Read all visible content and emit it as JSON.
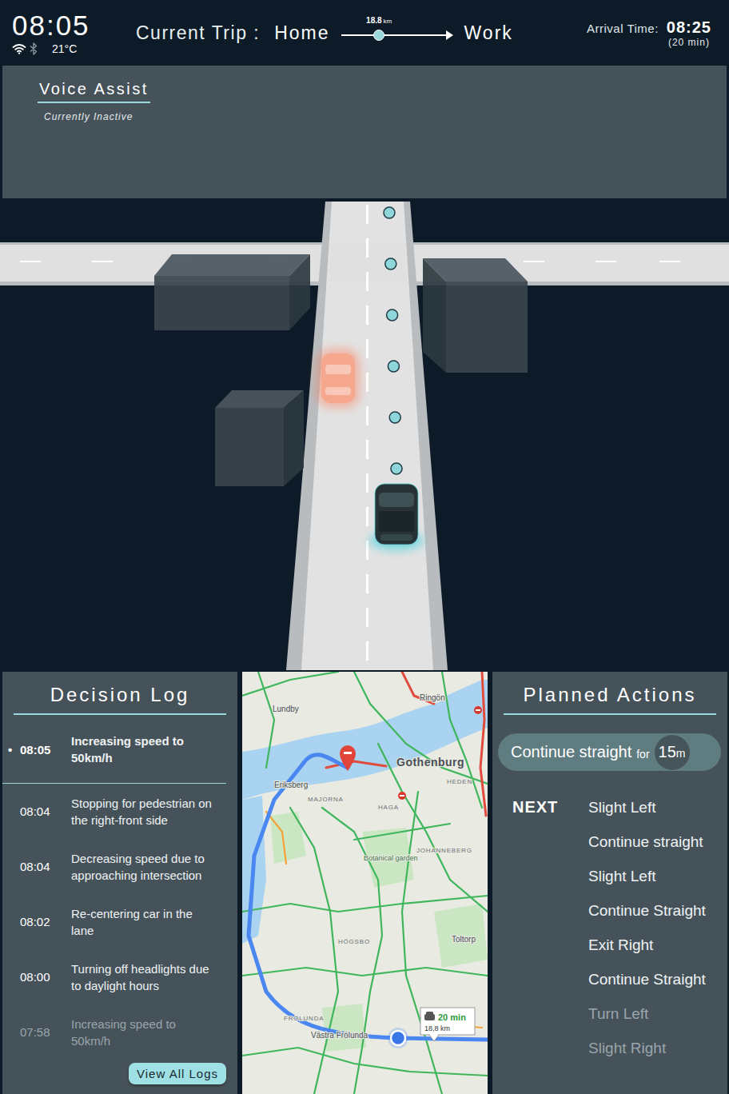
{
  "status": {
    "time": "08:05",
    "temperature": "21°C",
    "wifi": true,
    "bluetooth": false
  },
  "trip": {
    "label": "Current Trip :",
    "from": "Home",
    "to": "Work",
    "distance": "18.8",
    "distance_unit": "km",
    "level": 0.34
  },
  "arrival": {
    "label": "Arrival Time:",
    "time": "08:25",
    "duration": "(20 min)"
  },
  "voice_assist": {
    "title": "Voice Assist",
    "status": "Currently Inactive",
    "active": false
  },
  "scene": {
    "path_dots": 6,
    "vehicles": [
      {
        "kind": "other",
        "color": "#f6a88e"
      },
      {
        "kind": "ego",
        "color": "#5fd3dc"
      }
    ]
  },
  "decision_log": {
    "title": "Decision Log",
    "bullet": "•",
    "entries": [
      {
        "time": "08:05",
        "text": "Increasing speed to 50km/h",
        "current": true,
        "dimmed": false
      },
      {
        "time": "08:04",
        "text": "Stopping for pedestrian on the right-front side",
        "current": false,
        "dimmed": false
      },
      {
        "time": "08:04",
        "text": "Decreasing speed due to approaching intersection",
        "current": false,
        "dimmed": false
      },
      {
        "time": "08:02",
        "text": "Re-centering car in the lane",
        "current": false,
        "dimmed": false
      },
      {
        "time": "08:00",
        "text": "Turning off headlights due to daylight hours",
        "current": false,
        "dimmed": false
      },
      {
        "time": "07:58",
        "text": "Increasing speed to 50km/h",
        "current": false,
        "dimmed": true
      }
    ],
    "button": "View All Logs"
  },
  "map": {
    "labels": [
      {
        "text": "Lundby",
        "kind": "place"
      },
      {
        "text": "Ringön",
        "kind": "place"
      },
      {
        "text": "Gothenburg",
        "kind": "city"
      },
      {
        "text": "Eriksberg",
        "kind": "place"
      },
      {
        "text": "HEDEN",
        "kind": "district"
      },
      {
        "text": "MAJORNA",
        "kind": "district"
      },
      {
        "text": "HAGA",
        "kind": "district"
      },
      {
        "text": "JOHANNEBERG",
        "kind": "district"
      },
      {
        "text": "Botanical garden",
        "kind": "park"
      },
      {
        "text": "HÖGSBO",
        "kind": "district"
      },
      {
        "text": "Toltorp",
        "kind": "place"
      },
      {
        "text": "FRÖLUNDA",
        "kind": "district"
      },
      {
        "text": "Västra Frölunda",
        "kind": "place"
      }
    ],
    "route_badge": {
      "duration": "20 min",
      "distance": "18,8 km"
    }
  },
  "planned_actions": {
    "title": "Planned Actions",
    "current": {
      "action": "Continue straight",
      "connector": "for",
      "distance": "15",
      "unit": "m"
    },
    "next_label": "NEXT",
    "next": [
      {
        "text": "Slight Left",
        "dimmed": false
      },
      {
        "text": "Continue straight",
        "dimmed": false
      },
      {
        "text": "Slight Left",
        "dimmed": false
      },
      {
        "text": "Continue Straight",
        "dimmed": false
      },
      {
        "text": "Exit Right",
        "dimmed": false
      },
      {
        "text": "Continue Straight",
        "dimmed": false
      },
      {
        "text": "Turn Left",
        "dimmed": true
      },
      {
        "text": "Slight Right",
        "dimmed": true
      }
    ]
  }
}
